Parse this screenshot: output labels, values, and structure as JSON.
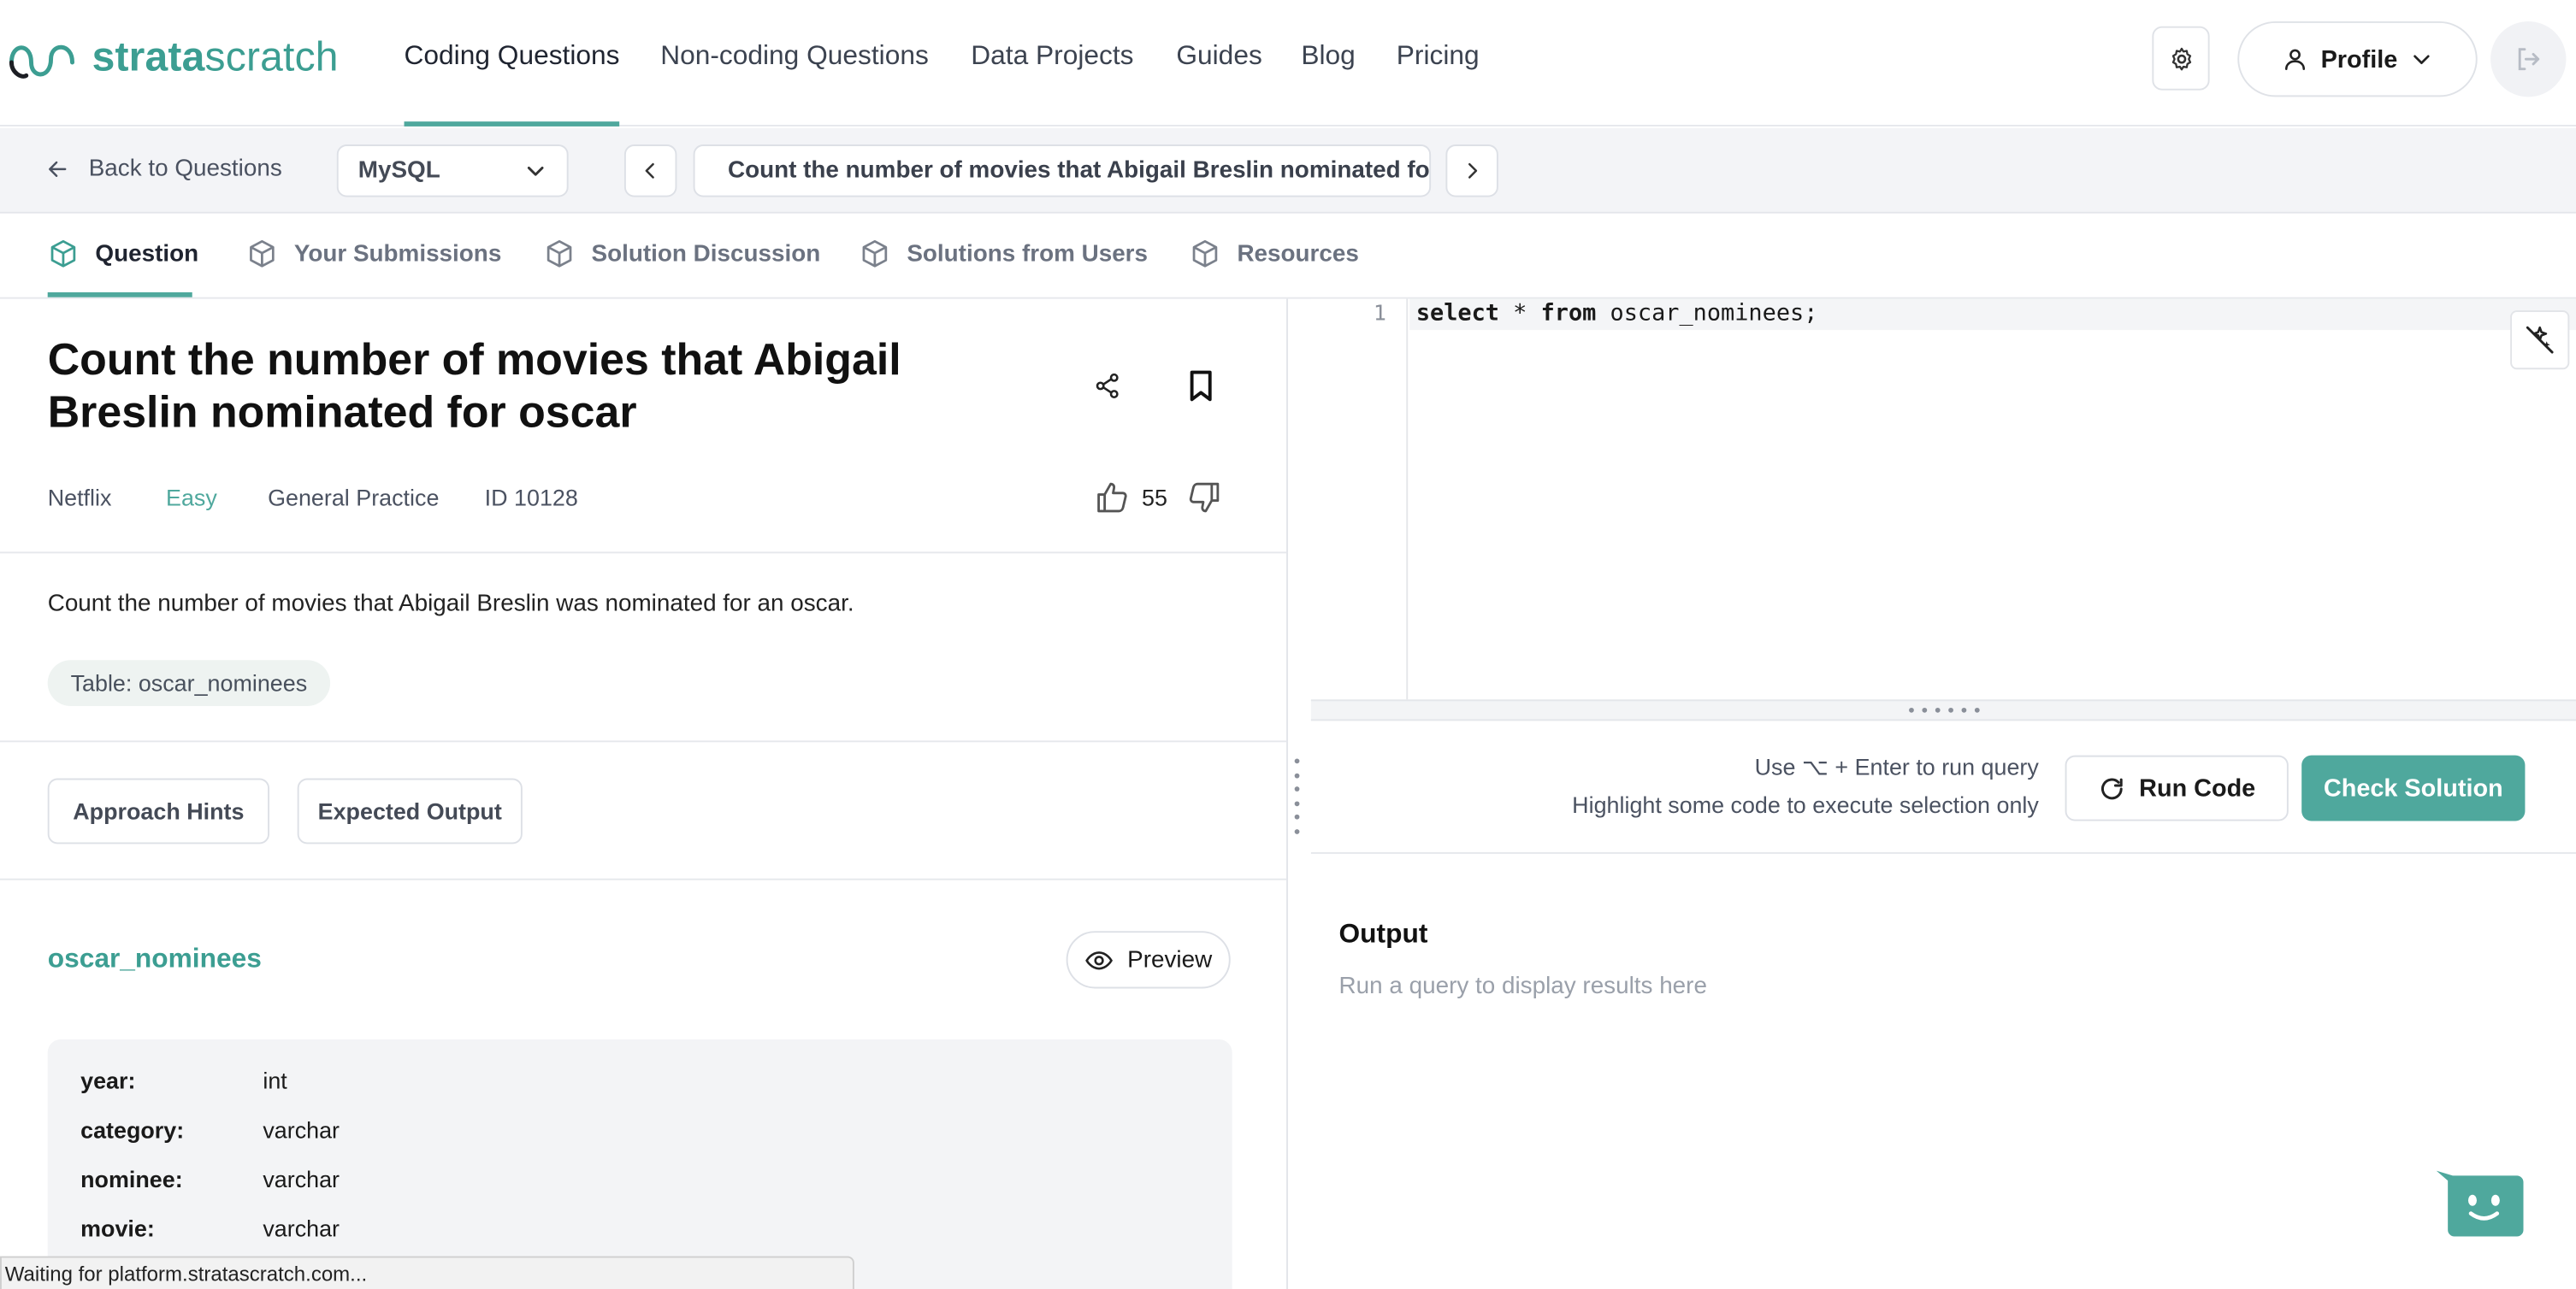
{
  "brand": {
    "strong": "strata",
    "light": "scratch"
  },
  "nav": {
    "links": [
      "Coding Questions",
      "Non-coding Questions",
      "Data Projects",
      "Guides",
      "Blog",
      "Pricing"
    ],
    "profile_label": "Profile"
  },
  "subbar": {
    "back_label": "Back to Questions",
    "language": "MySQL",
    "question_title": "Count the number of movies that Abigail Breslin nominated for oscar"
  },
  "tabs": [
    "Question",
    "Your Submissions",
    "Solution Discussion",
    "Solutions from Users",
    "Resources"
  ],
  "question": {
    "title": "Count the number of movies that Abigail Breslin nominated for oscar",
    "company": "Netflix",
    "difficulty": "Easy",
    "category": "General Practice",
    "id_label": "ID 10128",
    "votes": "55",
    "description": "Count the number of movies that Abigail Breslin was nominated for an oscar.",
    "table_chip": "Table: oscar_nominees",
    "approach_hints": "Approach Hints",
    "expected_output": "Expected Output"
  },
  "schema": {
    "table_name": "oscar_nominees",
    "preview_label": "Preview",
    "columns": [
      {
        "name": "year:",
        "type": "int"
      },
      {
        "name": "category:",
        "type": "varchar"
      },
      {
        "name": "nominee:",
        "type": "varchar"
      },
      {
        "name": "movie:",
        "type": "varchar"
      }
    ]
  },
  "editor": {
    "line_number": "1",
    "code": {
      "kw1": "select",
      "op": " * ",
      "kw2": "from",
      "rest": " oscar_nominees;"
    }
  },
  "run": {
    "hint_line1": "Use ⌥ + Enter to run query",
    "hint_line2": "Highlight some code to execute selection only",
    "run_label": "Run Code",
    "check_label": "Check Solution"
  },
  "output": {
    "title": "Output",
    "empty": "Run a query to display results here"
  },
  "status_text": "Waiting for platform.stratascratch.com...",
  "colors": {
    "accent": "#4fa89d",
    "brand": "#3c9e92"
  }
}
